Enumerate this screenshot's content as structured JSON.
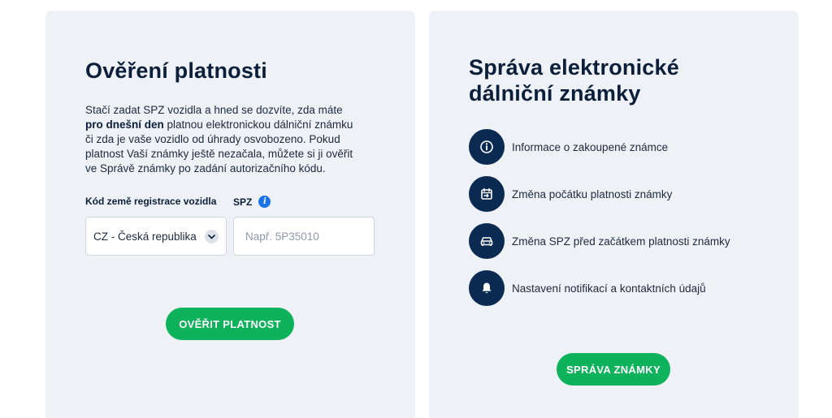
{
  "left_card": {
    "title": "Ověření platnosti",
    "intro_part1": "Stačí zadat SPZ vozidla a hned se dozvíte, zda máte ",
    "intro_bold": "pro dnešní den",
    "intro_part2": " platnou elektronickou dálniční známku či zda je vaše vozidlo od úhrady osvobozeno. Pokud platnost Vaší známky ještě nezačala, můžete si ji ověřit ve Správě známky po zadání autorizačního kódu.",
    "country_label": "Kód země registrace vozidla",
    "country_value": "CZ - Česká republika",
    "spz_label": "SPZ",
    "spz_info_glyph": "i",
    "spz_placeholder": "Např. 5P35010",
    "verify_button": "OVĚŘIT PLATNOST"
  },
  "right_card": {
    "title_line1": "Správa elektronické",
    "title_line2": "dálniční známky",
    "features": [
      {
        "icon": "info-icon",
        "label": "Informace o zakoupené známce"
      },
      {
        "icon": "calendar-icon",
        "label": "Změna počátku platnosti známky"
      },
      {
        "icon": "car-icon",
        "label": "Změna SPZ před začátkem platnosti známky"
      },
      {
        "icon": "bell-icon",
        "label": "Nastavení notifikací a kontaktních údajů"
      }
    ],
    "manage_button": "SPRÁVA ZNÁMKY"
  },
  "colors": {
    "card_bg": "#eef1f6",
    "navy": "#0b2a52",
    "green": "#0db25a",
    "info_blue": "#1a73e8"
  }
}
